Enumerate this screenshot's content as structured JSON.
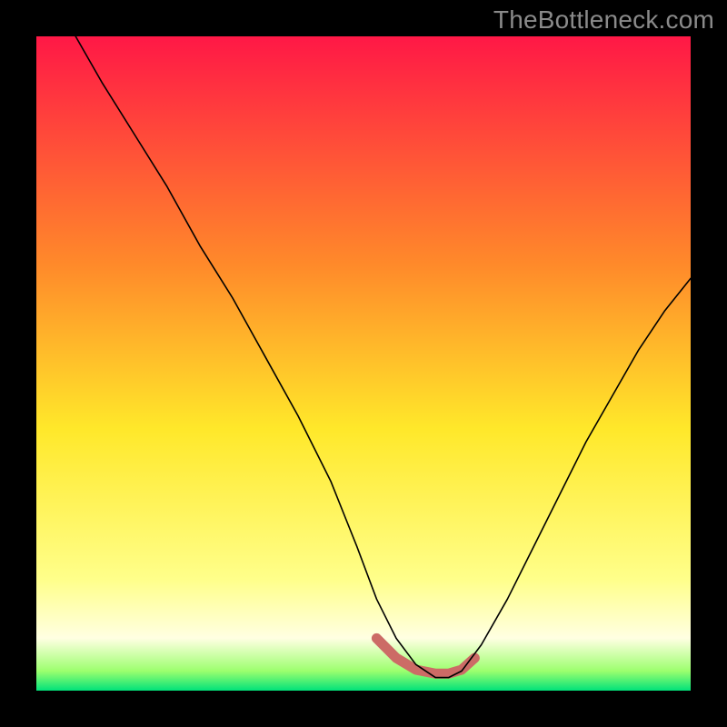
{
  "watermark": "TheBottleneck.com",
  "chart_data": {
    "type": "line",
    "title": "",
    "xlabel": "",
    "ylabel": "",
    "xlim": [
      0,
      100
    ],
    "ylim": [
      0,
      100
    ],
    "grid": false,
    "legend": false,
    "background_gradient": {
      "stops": [
        {
          "pos": 0.0,
          "color": "#ff1846"
        },
        {
          "pos": 0.35,
          "color": "#ff8a2a"
        },
        {
          "pos": 0.6,
          "color": "#ffe82a"
        },
        {
          "pos": 0.83,
          "color": "#ffff8a"
        },
        {
          "pos": 0.92,
          "color": "#ffffe2"
        },
        {
          "pos": 0.97,
          "color": "#9cff6e"
        },
        {
          "pos": 1.0,
          "color": "#00e27a"
        }
      ]
    },
    "series": [
      {
        "name": "curve",
        "stroke": "#000000",
        "stroke_width": 1.6,
        "x": [
          6,
          10,
          15,
          20,
          25,
          30,
          35,
          40,
          45,
          49,
          52,
          55,
          58,
          61,
          63,
          65,
          68,
          72,
          76,
          80,
          84,
          88,
          92,
          96,
          100
        ],
        "values": [
          100,
          93,
          85,
          77,
          68,
          60,
          51,
          42,
          32,
          22,
          14,
          8,
          4,
          2,
          2,
          3,
          7,
          14,
          22,
          30,
          38,
          45,
          52,
          58,
          63
        ]
      },
      {
        "name": "highlight-band",
        "type": "marker-band",
        "stroke": "#cc6b66",
        "stroke_width": 11,
        "x": [
          52,
          55,
          58,
          61,
          63,
          65,
          67
        ],
        "values": [
          8,
          5,
          3.2,
          2.6,
          2.6,
          3.2,
          5
        ]
      }
    ]
  }
}
